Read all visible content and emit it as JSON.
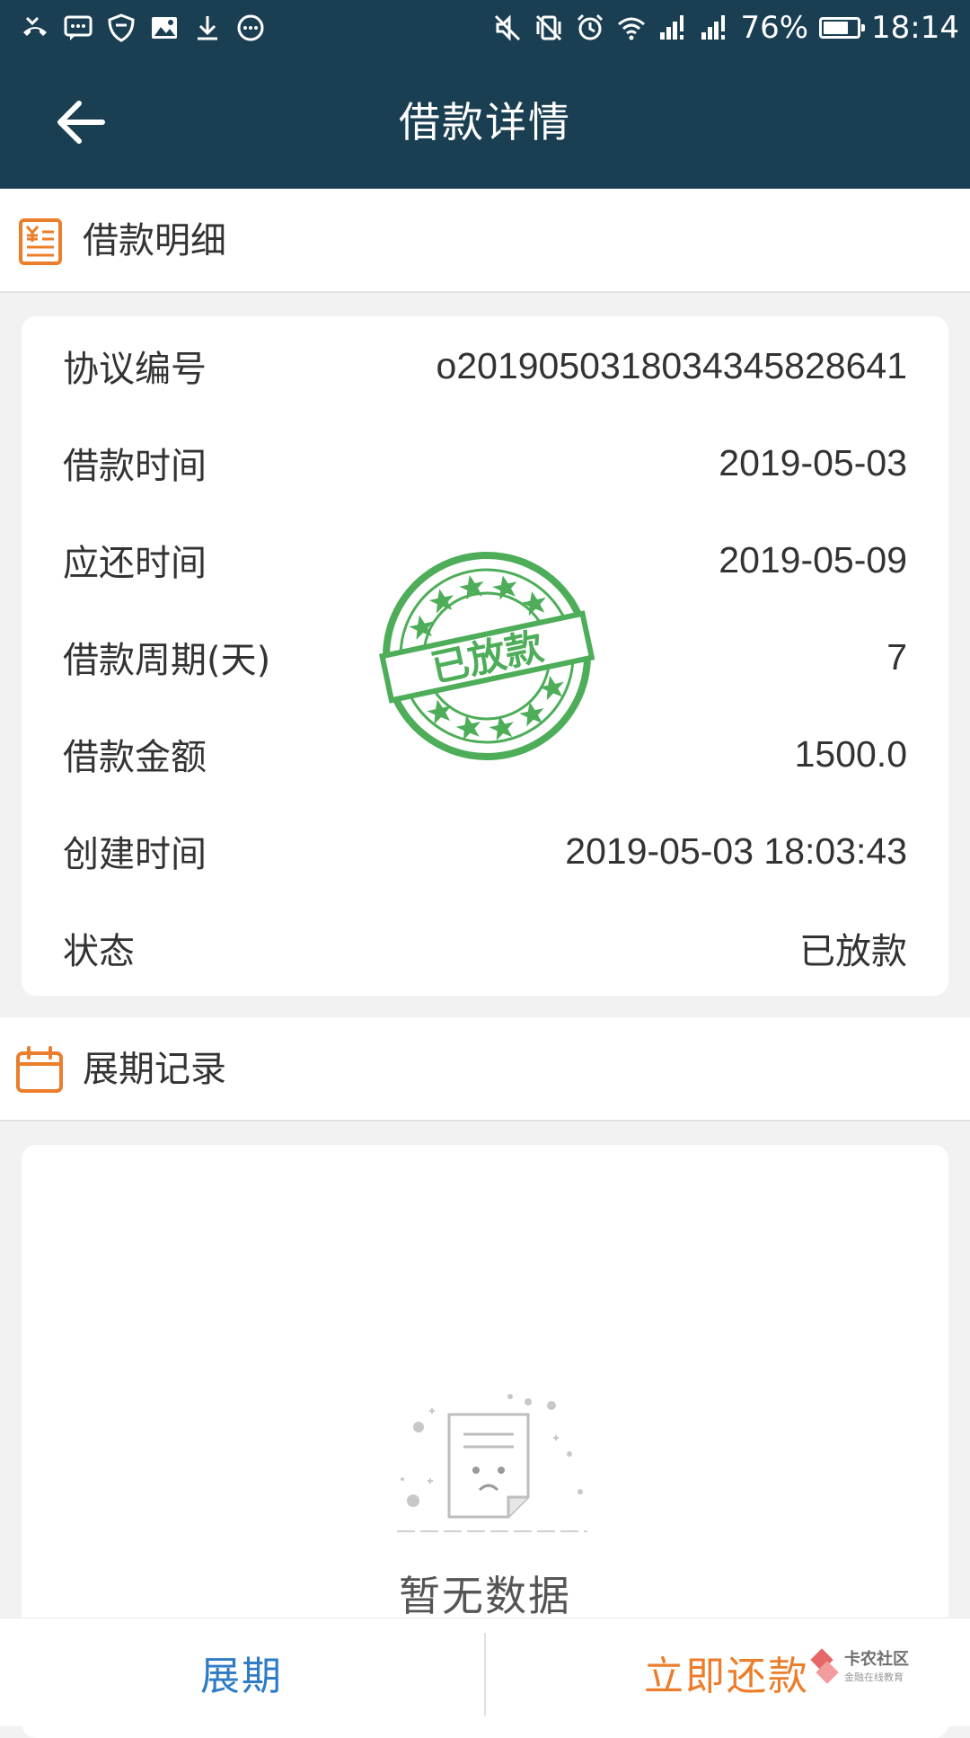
{
  "status_bar": {
    "left_icons": [
      "missed-call-icon",
      "message-icon",
      "shield-icon",
      "image-icon",
      "download-icon",
      "more-dots-icon"
    ],
    "right_icons": [
      "mute-icon",
      "vibrate-off-icon",
      "alarm-icon",
      "wifi-icon",
      "signal-icon",
      "signal-icon"
    ],
    "battery_text": "76%",
    "battery_level": 0.76,
    "time": "18:14"
  },
  "app_bar": {
    "title": "借款详情",
    "back_icon": "back-arrow-icon"
  },
  "loan_section": {
    "title": "借款明细",
    "icon": "receipt-yen-icon",
    "rows": [
      {
        "label": "协议编号",
        "value": "o2019050318034345828641"
      },
      {
        "label": "借款时间",
        "value": "2019-05-03"
      },
      {
        "label": "应还时间",
        "value": "2019-05-09"
      },
      {
        "label": "借款周期(天)",
        "value": "7"
      },
      {
        "label": "借款金额",
        "value": "1500.0"
      },
      {
        "label": "创建时间",
        "value": "2019-05-03 18:03:43"
      },
      {
        "label": "状态",
        "value": "已放款"
      }
    ],
    "stamp_text": "已放款"
  },
  "extension_section": {
    "title": "展期记录",
    "icon": "calendar-icon",
    "empty_text": "暂无数据"
  },
  "bottom_bar": {
    "extend_label": "展期",
    "repay_label": "立即还款"
  },
  "watermark": {
    "text": "卡农社区",
    "subtext": "金融在线教育"
  },
  "colors": {
    "header_bg": "#1b3f52",
    "accent_orange": "#ec7d2b",
    "link_blue": "#2f7bc4",
    "stamp_green": "#3aa547"
  }
}
